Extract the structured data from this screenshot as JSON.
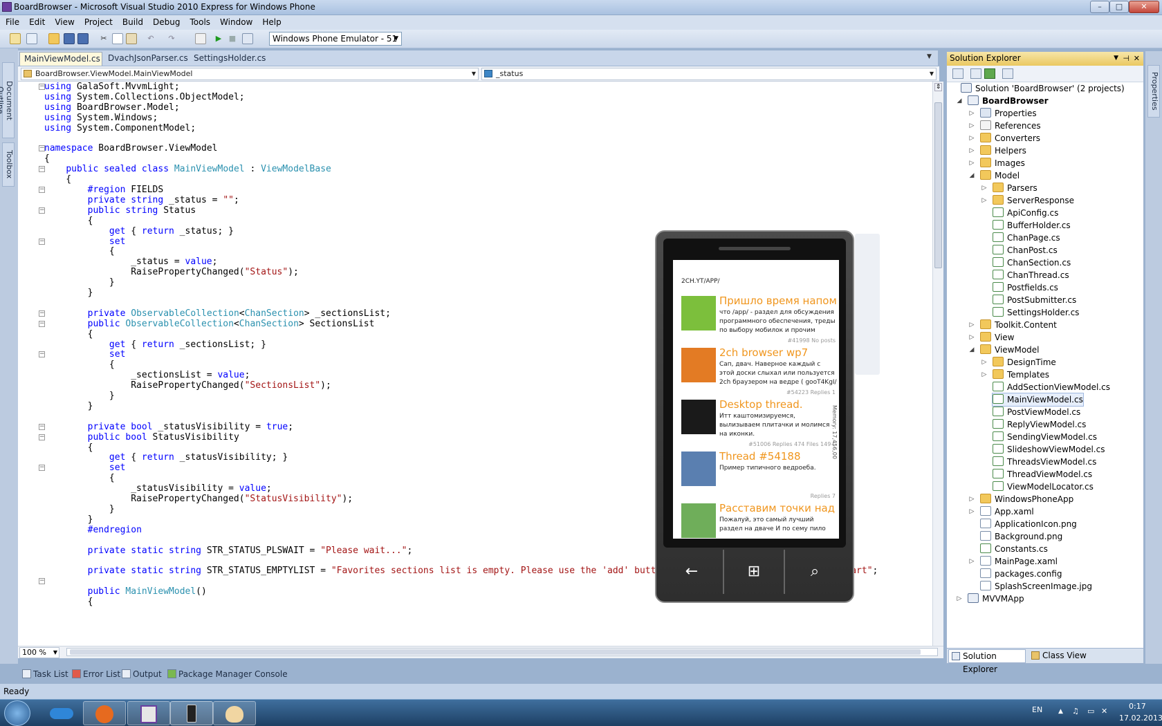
{
  "window": {
    "title": "BoardBrowser - Microsoft Visual Studio 2010 Express for Windows Phone",
    "min": "–",
    "max": "□",
    "close": "✕"
  },
  "menu": [
    "File",
    "Edit",
    "View",
    "Project",
    "Build",
    "Debug",
    "Tools",
    "Window",
    "Help"
  ],
  "toolbar": {
    "target": "Windows Phone Emulator - 51"
  },
  "left_tabs": [
    "Document Outline",
    "Toolbox"
  ],
  "right_tabs": [
    "Properties"
  ],
  "doc_tabs": [
    "MainViewModel.cs",
    "DvachJsonParser.cs",
    "SettingsHolder.cs"
  ],
  "nav": {
    "class_selector": "BoardBrowser.ViewModel.MainViewModel",
    "member_selector": "_status"
  },
  "code_lines": [
    "using GalaSoft.MvvmLight;",
    "using System.Collections.ObjectModel;",
    "using BoardBrowser.Model;",
    "using System.Windows;",
    "using System.ComponentModel;",
    "",
    "namespace BoardBrowser.ViewModel",
    "{",
    "    public sealed class MainViewModel : ViewModelBase",
    "    {",
    "        #region FIELDS",
    "        private string _status = \"\";",
    "        public string Status",
    "        {",
    "            get { return _status; }",
    "            set",
    "            {",
    "                _status = value;",
    "                RaisePropertyChanged(\"Status\");",
    "            }",
    "        }",
    "",
    "        private ObservableCollection<ChanSection> _sectionsList;",
    "        public ObservableCollection<ChanSection> SectionsList",
    "        {",
    "            get { return _sectionsList; }",
    "            set",
    "            {",
    "                _sectionsList = value;",
    "                RaisePropertyChanged(\"SectionsList\");",
    "            }",
    "        }",
    "",
    "        private bool _statusVisibility = true;",
    "        public bool StatusVisibility",
    "        {",
    "            get { return _statusVisibility; }",
    "            set",
    "            {",
    "                _statusVisibility = value;",
    "                RaisePropertyChanged(\"StatusVisibility\");",
    "            }",
    "        }",
    "        #endregion",
    "",
    "        private static string STR_STATUS_PLSWAIT = \"Please wait...\";",
    "",
    "        private static string STR_STATUS_EMPTYLIST = \"Favorites sections list is empty. Please use the 'add' button to add at least one section to start\";",
    "",
    "        public MainViewModel()",
    "        {"
  ],
  "fold_lines": [
    0,
    6,
    8,
    10,
    12,
    15,
    22,
    23,
    26,
    33,
    34,
    37,
    48
  ],
  "zoom": "100 %",
  "bottom_tabs": [
    "Task List",
    "Error List",
    "Output",
    "Package Manager Console"
  ],
  "status": "Ready",
  "solution_explorer": {
    "title": "Solution Explorer",
    "nodes": [
      {
        "label": "Solution 'BoardBrowser' (2 projects)",
        "level": 0,
        "icon": "solution",
        "arrow": ""
      },
      {
        "label": "BoardBrowser",
        "level": 0,
        "icon": "proj",
        "arrow": "◢",
        "bold": true
      },
      {
        "label": "Properties",
        "level": 1,
        "icon": "props",
        "arrow": "▷"
      },
      {
        "label": "References",
        "level": 1,
        "icon": "refs",
        "arrow": "▷"
      },
      {
        "label": "Converters",
        "level": 1,
        "icon": "folder",
        "arrow": "▷"
      },
      {
        "label": "Helpers",
        "level": 1,
        "icon": "folder",
        "arrow": "▷"
      },
      {
        "label": "Images",
        "level": 1,
        "icon": "folder",
        "arrow": "▷"
      },
      {
        "label": "Model",
        "level": 1,
        "icon": "folder",
        "arrow": "◢"
      },
      {
        "label": "Parsers",
        "level": 2,
        "icon": "folder",
        "arrow": "▷"
      },
      {
        "label": "ServerResponse",
        "level": 2,
        "icon": "folder",
        "arrow": "▷"
      },
      {
        "label": "ApiConfig.cs",
        "level": 2,
        "icon": "cs",
        "arrow": ""
      },
      {
        "label": "BufferHolder.cs",
        "level": 2,
        "icon": "cs",
        "arrow": ""
      },
      {
        "label": "ChanPage.cs",
        "level": 2,
        "icon": "cs",
        "arrow": ""
      },
      {
        "label": "ChanPost.cs",
        "level": 2,
        "icon": "cs",
        "arrow": ""
      },
      {
        "label": "ChanSection.cs",
        "level": 2,
        "icon": "cs",
        "arrow": ""
      },
      {
        "label": "ChanThread.cs",
        "level": 2,
        "icon": "cs",
        "arrow": ""
      },
      {
        "label": "Postfields.cs",
        "level": 2,
        "icon": "cs",
        "arrow": ""
      },
      {
        "label": "PostSubmitter.cs",
        "level": 2,
        "icon": "cs",
        "arrow": ""
      },
      {
        "label": "SettingsHolder.cs",
        "level": 2,
        "icon": "cs",
        "arrow": ""
      },
      {
        "label": "Toolkit.Content",
        "level": 1,
        "icon": "folder",
        "arrow": "▷"
      },
      {
        "label": "View",
        "level": 1,
        "icon": "folder",
        "arrow": "▷"
      },
      {
        "label": "ViewModel",
        "level": 1,
        "icon": "folder",
        "arrow": "◢"
      },
      {
        "label": "DesignTime",
        "level": 2,
        "icon": "folder",
        "arrow": "▷"
      },
      {
        "label": "Templates",
        "level": 2,
        "icon": "folder",
        "arrow": "▷"
      },
      {
        "label": "AddSectionViewModel.cs",
        "level": 2,
        "icon": "cs",
        "arrow": ""
      },
      {
        "label": "MainViewModel.cs",
        "level": 2,
        "icon": "cs",
        "arrow": "",
        "selected": true
      },
      {
        "label": "PostViewModel.cs",
        "level": 2,
        "icon": "cs",
        "arrow": ""
      },
      {
        "label": "ReplyViewModel.cs",
        "level": 2,
        "icon": "cs",
        "arrow": ""
      },
      {
        "label": "SendingViewModel.cs",
        "level": 2,
        "icon": "cs",
        "arrow": ""
      },
      {
        "label": "SlideshowViewModel.cs",
        "level": 2,
        "icon": "cs",
        "arrow": ""
      },
      {
        "label": "ThreadsViewModel.cs",
        "level": 2,
        "icon": "cs",
        "arrow": ""
      },
      {
        "label": "ThreadViewModel.cs",
        "level": 2,
        "icon": "cs",
        "arrow": ""
      },
      {
        "label": "ViewModelLocator.cs",
        "level": 2,
        "icon": "cs",
        "arrow": ""
      },
      {
        "label": "WindowsPhoneApp",
        "level": 1,
        "icon": "folder",
        "arrow": "▷"
      },
      {
        "label": "App.xaml",
        "level": 1,
        "icon": "file",
        "arrow": "▷"
      },
      {
        "label": "ApplicationIcon.png",
        "level": 1,
        "icon": "file",
        "arrow": ""
      },
      {
        "label": "Background.png",
        "level": 1,
        "icon": "file",
        "arrow": ""
      },
      {
        "label": "Constants.cs",
        "level": 1,
        "icon": "cs",
        "arrow": ""
      },
      {
        "label": "MainPage.xaml",
        "level": 1,
        "icon": "file",
        "arrow": "▷"
      },
      {
        "label": "packages.config",
        "level": 1,
        "icon": "file",
        "arrow": ""
      },
      {
        "label": "SplashScreenImage.jpg",
        "level": 1,
        "icon": "file",
        "arrow": ""
      },
      {
        "label": "MVVMApp",
        "level": 0,
        "icon": "proj",
        "arrow": "▷"
      }
    ],
    "bottom_tabs": [
      "Solution Explorer",
      "Class View"
    ]
  },
  "phone": {
    "crumb": "2CH.YT/APP/",
    "memory": "Memory: 17,456,00",
    "posts": [
      {
        "title": "Пришло время напомн",
        "body": "что /app/ - раздел для обсуждения программного обеспечения, треды по выбору мобилок и прочим",
        "meta": "#41998 No posts",
        "thumb": "#7cbf3c"
      },
      {
        "title": "2ch browser wp7",
        "body": "Сап, двач. Наверное каждый с этой доски слыхал или пользуется 2ch браузером на ведре ( gooT4KgI/",
        "meta": "#54223 Replies 1",
        "thumb": "#e37b24"
      },
      {
        "title": "Desktop thread.",
        "body": "Итт каштомизируемся, вылизываем плитачки и молимся на иконки.",
        "meta": "#51006 Replies 474 Files 149+",
        "thumb": "#1a1a1a"
      },
      {
        "title": "Thread #54188",
        "body": "Пример типичного ведроеба.",
        "meta": "Replies 7",
        "thumb": "#5a7fb0"
      },
      {
        "title": "Расставим точки над ђ",
        "body": "Пожалуй, это самый лучший раздел на дваче И по сему пило",
        "meta": "",
        "thumb": "#6fae5a"
      }
    ],
    "buttons": {
      "back": "←",
      "start": "⊞",
      "search": "⌕"
    }
  },
  "tray": {
    "lang": "EN",
    "time": "0:17",
    "date": "17.02.2013"
  },
  "colors": {
    "keyword": "#0000ff",
    "type": "#2b91af",
    "string": "#a31515",
    "accent": "#f0961e"
  }
}
